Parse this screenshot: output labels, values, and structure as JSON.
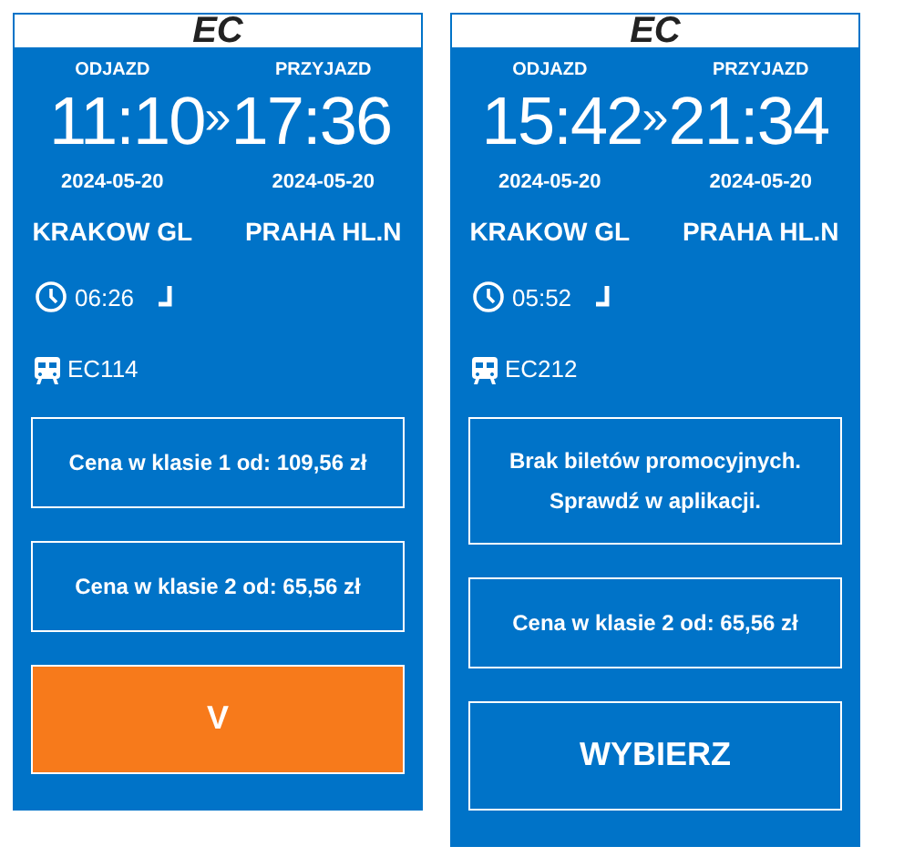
{
  "cards": [
    {
      "category": "EC",
      "departure_label": "ODJAZD",
      "arrival_label": "PRZYJAZD",
      "departure_time": "11:10",
      "separator": "»",
      "arrival_time": "17:36",
      "departure_date": "2024-05-20",
      "arrival_date": "2024-05-20",
      "from": "KRAKOW GL",
      "to": "PRAHA HL.N",
      "duration": "06:26",
      "train": "EC114",
      "offers": [
        "Cena w klasie 1 od: 109,56 zł",
        "Cena w klasie 2 od: 65,56 zł"
      ],
      "button": {
        "label": "V",
        "selected": true
      }
    },
    {
      "category": "EC",
      "departure_label": "ODJAZD",
      "arrival_label": "PRZYJAZD",
      "departure_time": "15:42",
      "separator": "»",
      "arrival_time": "21:34",
      "departure_date": "2024-05-20",
      "arrival_date": "2024-05-20",
      "from": "KRAKOW GL",
      "to": "PRAHA HL.N",
      "duration": "05:52",
      "train": "EC212",
      "offers": [
        "Brak biletów promocyjnych. Sprawdź w aplikacji.",
        "Cena w klasie 2 od: 65,56 zł"
      ],
      "button": {
        "label": "WYBIERZ",
        "selected": false
      }
    }
  ]
}
